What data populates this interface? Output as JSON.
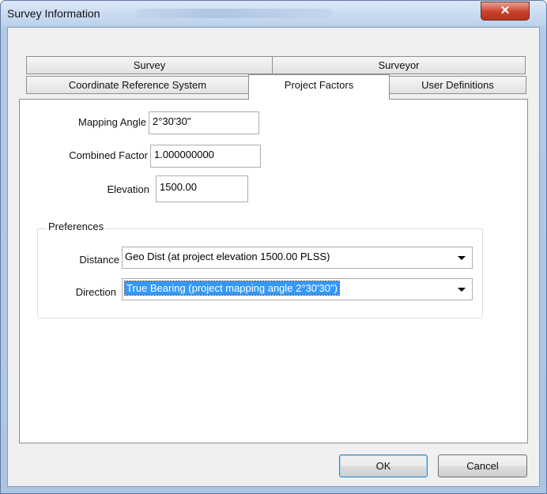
{
  "window": {
    "title": "Survey Information",
    "close_glyph": "✕"
  },
  "tabs": {
    "row_back": [
      {
        "label": "Survey"
      },
      {
        "label": "Surveyor"
      }
    ],
    "row_front": [
      {
        "label": "Coordinate Reference System"
      },
      {
        "label": "Project Factors"
      },
      {
        "label": "User Definitions"
      }
    ],
    "active": "Project Factors"
  },
  "project_factors": {
    "mapping_angle": {
      "label": "Mapping Angle",
      "value": "2°30'30\""
    },
    "combined_factor": {
      "label": "Combined Factor",
      "value": "1.000000000"
    },
    "elevation": {
      "label": "Elevation",
      "value": "1500.00"
    }
  },
  "preferences": {
    "title": "Preferences",
    "distance": {
      "label": "Distance",
      "value": "Geo Dist (at project elevation 1500.00 PLSS)"
    },
    "direction": {
      "label": "Direction",
      "value": "True Bearing (project mapping angle 2°30'30\")"
    }
  },
  "buttons": {
    "ok": "OK",
    "cancel": "Cancel"
  },
  "colors": {
    "close_button": "#c8412c",
    "selection": "#3399ff",
    "title_bar": "#c5d7ee"
  }
}
